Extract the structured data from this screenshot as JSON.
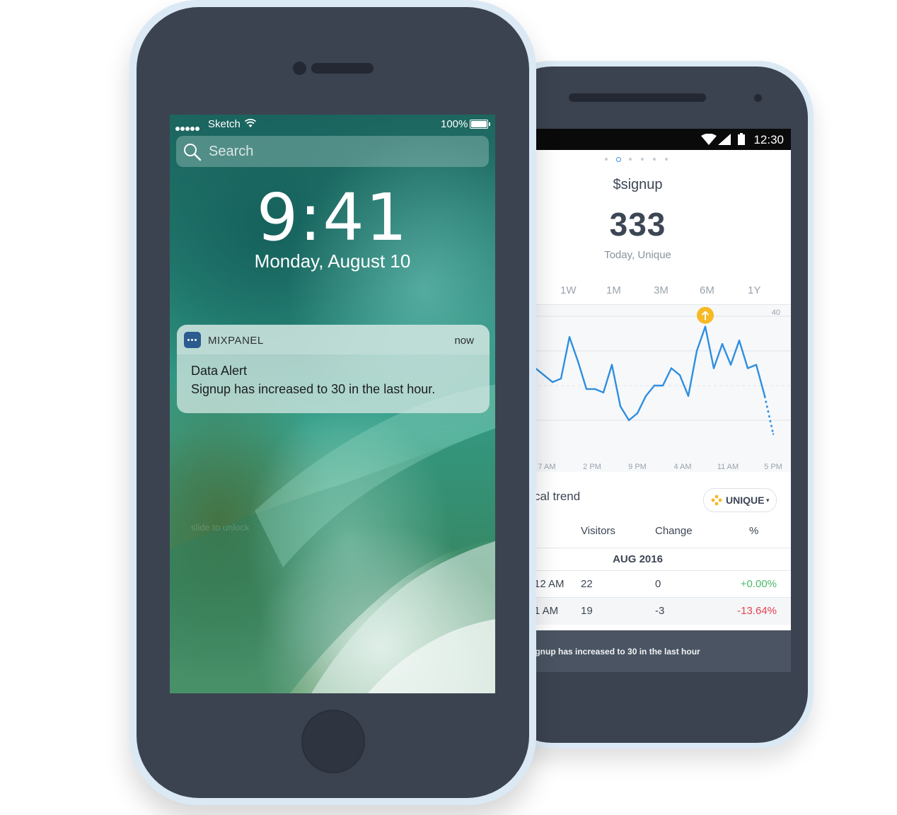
{
  "android": {
    "status": {
      "time": "12:30"
    },
    "event_name": "$signup",
    "event_value": "333",
    "event_sub": "Today, Unique",
    "ranges": [
      "1W",
      "1M",
      "3M",
      "6M",
      "1Y"
    ],
    "trend_label": "cal trend",
    "unique_button": "UNIQUE",
    "unique_caret": "▾",
    "table": {
      "headers": [
        "Visitors",
        "Change",
        "%"
      ],
      "month": "AUG 2016",
      "rows": [
        {
          "time": "12 AM",
          "visitors": "22",
          "change": "0",
          "pct": "+0.00%"
        },
        {
          "time": "1 AM",
          "visitors": "19",
          "change": "-3",
          "pct": "-13.64%"
        }
      ]
    },
    "toast": "ignup has increased to 30 in the last hour",
    "colors": {
      "line": "#2f8ee0",
      "marker": "#f7b924",
      "positive": "#4cb96a",
      "negative": "#e5414e"
    },
    "chart_data": {
      "type": "line",
      "ylim": [
        0,
        40
      ],
      "y_tick_labels": [
        "40"
      ],
      "x_tick_labels": [
        "7 AM",
        "2 PM",
        "9 PM",
        "4 AM",
        "11 AM",
        "5 PM"
      ],
      "values": [
        25,
        23,
        21,
        22,
        34,
        27,
        19,
        19,
        18,
        26,
        14,
        10,
        12,
        17,
        20,
        20,
        25,
        23,
        17,
        30,
        37,
        25,
        32,
        26,
        33,
        25,
        26,
        17,
        6
      ],
      "marker_index": 20,
      "marker_icon": "arrow-up-icon"
    }
  },
  "iphone": {
    "status": {
      "carrier": "Sketch",
      "battery": "100%"
    },
    "search_placeholder": "Search",
    "time": "9:41",
    "date": "Monday, August 10",
    "notification": {
      "app": "MIXPANEL",
      "time": "now",
      "title": "Data Alert",
      "body": "Signup has increased to 30 in the last hour."
    },
    "slide_hint": "slide to unlock"
  }
}
